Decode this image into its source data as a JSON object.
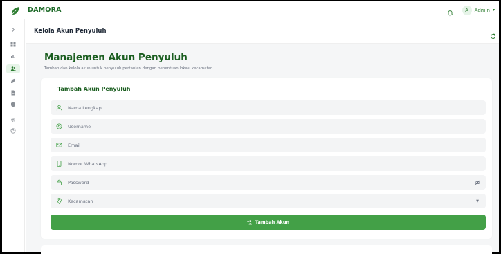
{
  "app": {
    "brand": "DAMORA"
  },
  "header": {
    "avatar_initial": "A",
    "user_label": "Admin",
    "user_caret": "▾"
  },
  "sidebar": {
    "items": [
      {
        "icon": "chevron-right-icon",
        "active": false
      },
      {
        "icon": "dashboard-icon",
        "active": false
      },
      {
        "icon": "chart-icon",
        "active": false
      },
      {
        "icon": "users-icon",
        "active": true
      },
      {
        "icon": "leaf-icon",
        "active": false
      },
      {
        "icon": "file-icon",
        "active": false
      },
      {
        "icon": "shield-icon",
        "active": false
      },
      {
        "icon": "gear-icon",
        "active": false
      },
      {
        "icon": "help-icon",
        "active": false
      }
    ]
  },
  "page": {
    "breadcrumb_title": "Kelola Akun Penyuluh",
    "title": "Manajemen Akun Penyuluh",
    "subtitle": "Tambah dan kelola akun untuk penyuluh pertanian dengan penentuan lokasi kecamatan"
  },
  "form": {
    "title": "Tambah Akun Penyuluh",
    "fields": {
      "name": {
        "placeholder": "Nama Lengkap",
        "icon": "user-icon"
      },
      "username": {
        "placeholder": "Username",
        "icon": "at-icon"
      },
      "email": {
        "placeholder": "Email",
        "icon": "mail-icon"
      },
      "whatsapp": {
        "placeholder": "Nomor WhatsApp",
        "icon": "phone-icon"
      },
      "password": {
        "placeholder": "Password",
        "icon": "lock-icon"
      },
      "kecamatan": {
        "placeholder": "Kecamatan",
        "icon": "location-icon"
      }
    },
    "submit_label": "Tambah Akun",
    "select_caret": "▼"
  },
  "colors": {
    "brand": "#1f6b2a",
    "accent": "#43a047",
    "title": "#1b5e20"
  }
}
